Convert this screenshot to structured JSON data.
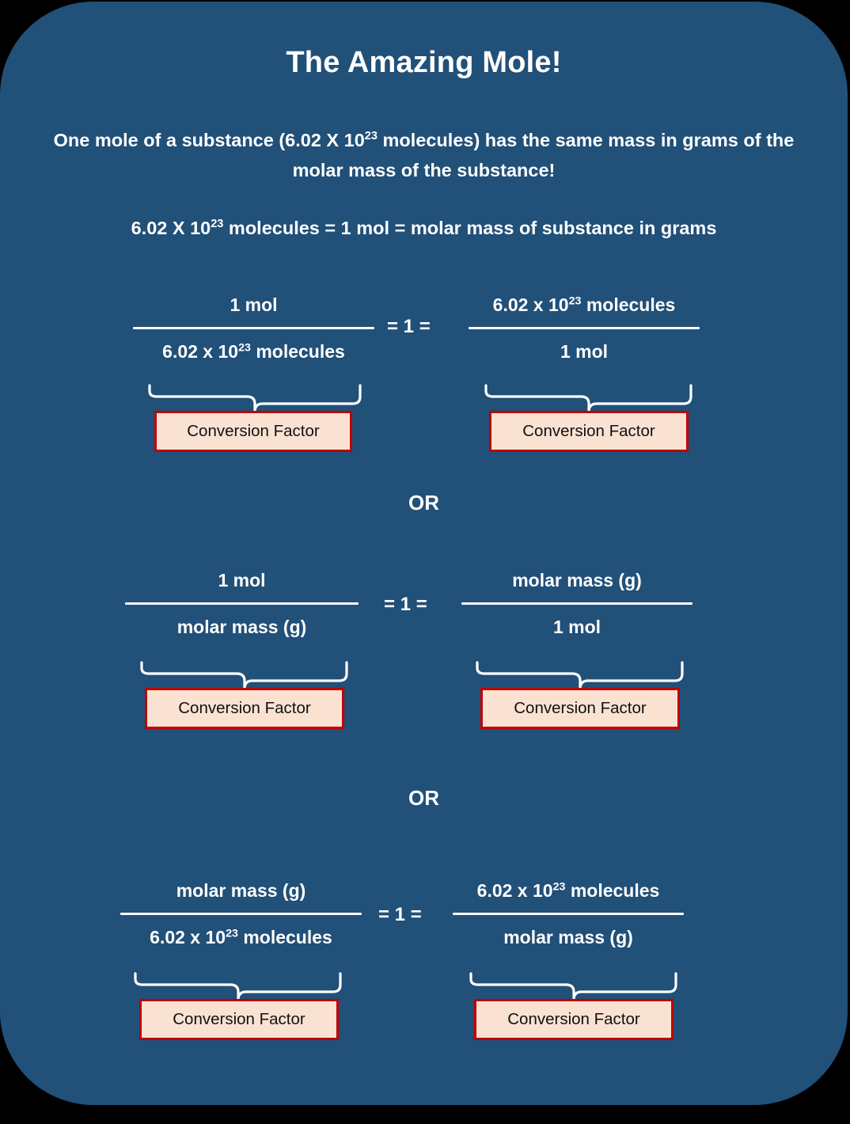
{
  "slide": {
    "title": "The Amazing Mole!",
    "background_color": "#215078",
    "text_color": "#ffffff",
    "box_fill_color": "#FAE2D2",
    "box_border_color": "#C00000",
    "subtitle_line_1": "One mole of a substance (6.02 X 10²³ molecules) has the same mass",
    "subtitle_line_2": "in grams of the molar mass of the substance!",
    "equation_line": "6.02 X 10²³ molecules = 1 mol = molar mass of substance in grams",
    "or_label": "OR",
    "equals_label": "= 1 =",
    "conversion_factor_label": "Conversion Factor"
  },
  "subtitle_parts": {
    "a": "One mole of a substance (6.02 X 10",
    "exp": "23",
    "b": " molecules) has the same mass in grams of the molar mass of the substance!"
  },
  "equation_parts": {
    "a": "6.02 X 10",
    "exp": "23",
    "b": " molecules = 1 mol = molar mass of substance in grams"
  },
  "rows": [
    {
      "id": "row-1",
      "left": {
        "numerator": "1 mol",
        "denominator_pre": "6.02 x 10",
        "denominator_exp": "23",
        "denominator_post": " molecules",
        "caption": "Conversion Factor"
      },
      "right": {
        "numerator_pre": "6.02 x 10",
        "numerator_exp": "23",
        "numerator_post": " molecules",
        "denominator": "1 mol",
        "caption": "Conversion Factor"
      },
      "operator": "= 1 ="
    },
    {
      "id": "row-2",
      "left": {
        "numerator": "1 mol",
        "denominator": "molar mass (g)",
        "caption": "Conversion Factor"
      },
      "right": {
        "numerator": "molar mass (g)",
        "denominator": "1 mol",
        "caption": "Conversion Factor"
      },
      "operator": "= 1 ="
    },
    {
      "id": "row-3",
      "left": {
        "numerator": "molar mass (g)",
        "denominator_pre": "6.02 x 10",
        "denominator_exp": "23",
        "denominator_post": " molecules",
        "caption": "Conversion Factor"
      },
      "right": {
        "numerator_pre": "6.02 x 10",
        "numerator_exp": "23",
        "numerator_post": " molecules",
        "denominator": "molar mass (g)",
        "caption": "Conversion Factor"
      },
      "operator": "= 1 ="
    }
  ]
}
